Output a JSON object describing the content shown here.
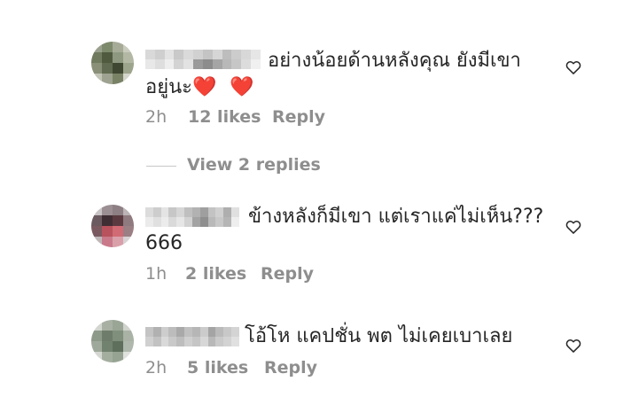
{
  "comments": [
    {
      "text_line1": "อย่างน้อยด้านหลังคุณ ยังมีเขา",
      "text_line2": "อยู่นะ",
      "emoji": "❤️ ❤️",
      "time": "2h",
      "likes": "12 likes",
      "reply": "Reply",
      "like_icon": "heart-outline-icon"
    },
    {
      "text_line1": "ข้างหลังก็มีเขา แต่เราแค่ไม่เห็น???",
      "text_line2": "666",
      "time": "1h",
      "likes": "2 likes",
      "reply": "Reply",
      "like_icon": "heart-outline-icon"
    },
    {
      "text_line1": "โอ้โห แคปชั่น พต ไม่เคยเบาเลย",
      "time": "2h",
      "likes": "5 likes",
      "reply": "Reply",
      "like_icon": "heart-outline-icon"
    }
  ],
  "view_replies": {
    "label": "View 2 replies"
  },
  "colors": {
    "primary_text": "#262626",
    "secondary_text": "#8e8e8e",
    "divider": "#c7c7c7",
    "heart_emoji": "#ed1c24"
  }
}
